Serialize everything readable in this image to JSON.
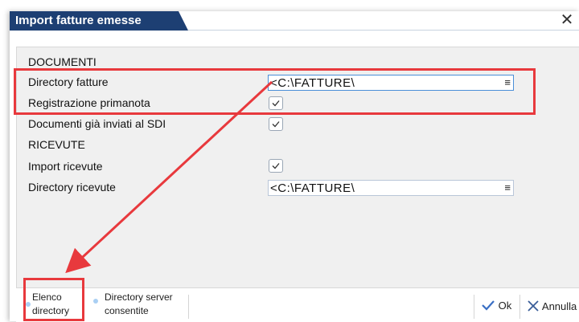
{
  "dialog": {
    "title": "Import fatture emesse",
    "close_icon": "close-icon"
  },
  "form": {
    "section_documenti": "DOCUMENTI",
    "directory_fatture_label": "Directory fatture",
    "directory_fatture_value": "<C:\\FATTURE\\",
    "registrazione_primanota_label": "Registrazione primanota",
    "registrazione_primanota_checked": true,
    "documenti_inviati_label": "Documenti già inviati al SDI",
    "documenti_inviati_checked": true,
    "section_ricevute": "RICEVUTE",
    "import_ricevute_label": "Import ricevute",
    "import_ricevute_checked": true,
    "directory_ricevute_label": "Directory ricevute",
    "directory_ricevute_value": "<C:\\FATTURE\\",
    "field_menu_glyph": "≡"
  },
  "footer": {
    "elenco_line1": "Elenco",
    "elenco_line2": "directory",
    "server_line1": "Directory server",
    "server_line2": "consentite",
    "ok_label": "Ok",
    "annulla_label": "Annulla"
  },
  "colors": {
    "title_bar": "#1d3f73",
    "highlight": "#e8393d",
    "panel": "#f0f0f0"
  }
}
